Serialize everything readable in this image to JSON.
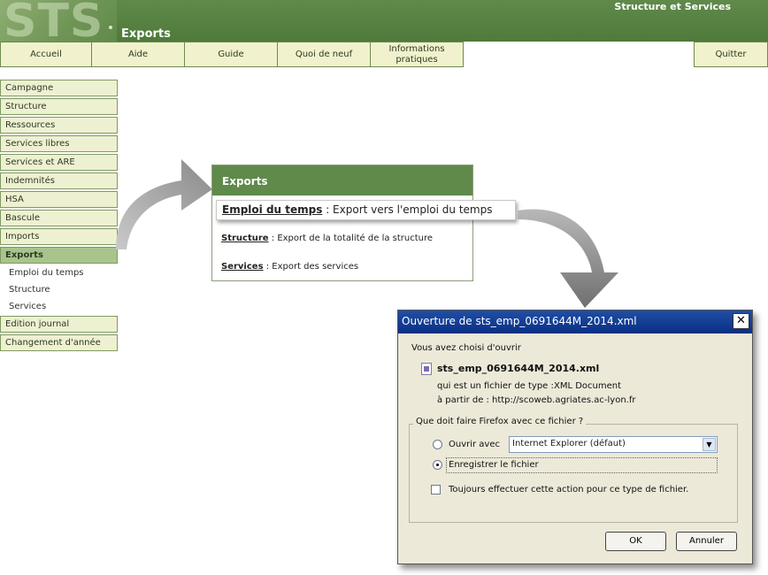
{
  "header": {
    "logo_text": "STS",
    "app_title": "Structure et Services",
    "page_title": "Exports"
  },
  "nav": {
    "items": [
      "Accueil",
      "Aide",
      "Guide",
      "Quoi de neuf",
      "Informations pratiques"
    ],
    "quit": "Quitter"
  },
  "sidebar": {
    "items": [
      "Campagne",
      "Structure",
      "Ressources",
      "Services libres",
      "Services et ARE",
      "Indemnités",
      "HSA",
      "Bascule",
      "Imports",
      "Exports"
    ],
    "active": "Exports",
    "subitems": [
      "Emploi du temps",
      "Structure",
      "Services"
    ],
    "bottom_items": [
      "Edition journal",
      "Changement d'année"
    ]
  },
  "exports": {
    "title": "Exports",
    "rows": [
      {
        "link": "Emploi du temps",
        "desc": ": Export vers l'emploi du temps"
      },
      {
        "link": "Structure",
        "desc": ": Export de la totalité de la structure"
      },
      {
        "link": "Services",
        "desc": ": Export des services"
      }
    ]
  },
  "dialog": {
    "title": "Ouverture de sts_emp_0691644M_2014.xml",
    "intro": "Vous avez choisi d'ouvrir",
    "filename": "sts_emp_0691644M_2014.xml",
    "type_label": "qui est un fichier de type :",
    "type_value": "XML Document",
    "from_label": "à partir de :",
    "from_value": "http://scoweb.agriates.ac-lyon.fr",
    "question": "Que doit faire Firefox avec ce fichier ?",
    "open_with_label": "Ouvrir avec",
    "open_with_app": "Internet Explorer (défaut)",
    "save_label": "Enregistrer le fichier",
    "always_label": "Toujours effectuer cette action pour ce type de fichier.",
    "selected_option": "save",
    "always_checked": false,
    "ok": "OK",
    "cancel": "Annuler"
  },
  "colors": {
    "header_green": "#5f8a4a",
    "nav_bg": "#f1f2cd",
    "dialog_title": "#0a2f84",
    "dialog_bg": "#ece9d8"
  }
}
